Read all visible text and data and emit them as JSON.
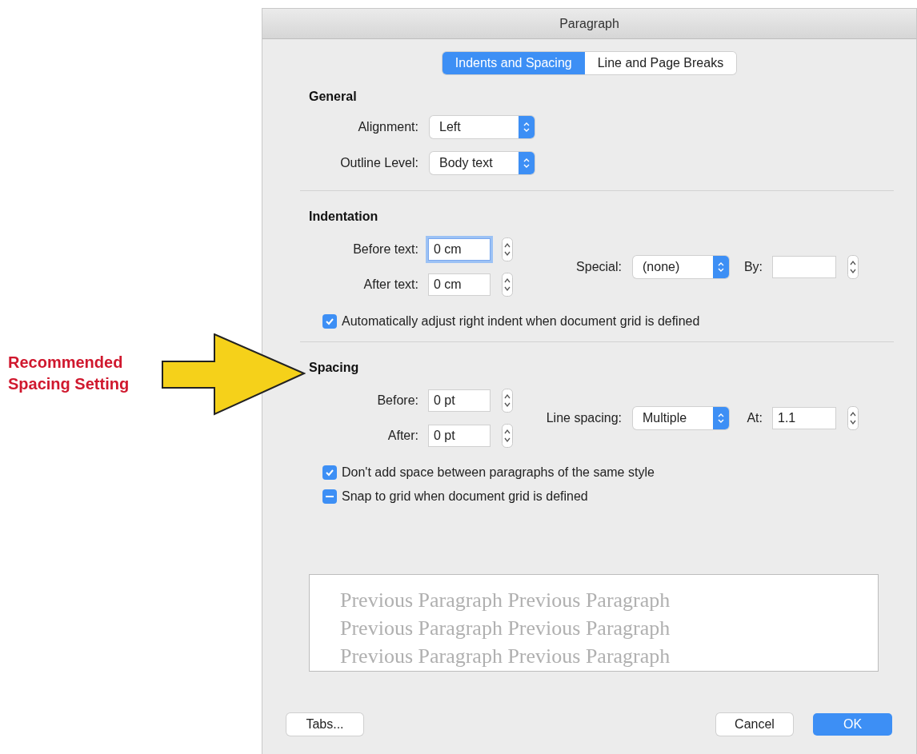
{
  "annotation": {
    "lines": [
      "Recommended",
      "Spacing Setting"
    ]
  },
  "dialog": {
    "title": "Paragraph",
    "tabs": [
      {
        "label": "Indents and Spacing",
        "selected": true
      },
      {
        "label": "Line and Page Breaks",
        "selected": false
      }
    ],
    "general": {
      "heading": "General",
      "popups": [
        {
          "label": "Alignment:",
          "value": "Left"
        },
        {
          "label": "Outline Level:",
          "value": "Body text"
        }
      ]
    },
    "indentation": {
      "heading": "Indentation",
      "fields": [
        {
          "label": "Before text:",
          "value": "0 cm",
          "focused": true
        },
        {
          "label": "After text:",
          "value": "0 cm",
          "focused": false
        }
      ],
      "popup": {
        "label": "Special:",
        "value": "(none)"
      },
      "extra_field": {
        "label": "By:",
        "focused": false
      },
      "checkboxes": [
        {
          "label": "Automatically adjust right indent when document grid is defined",
          "kind": "checkbox",
          "checked": true
        }
      ]
    },
    "spacing": {
      "heading": "Spacing",
      "fields": [
        {
          "label": "Before:",
          "value": "0 pt",
          "focused": false
        },
        {
          "label": "After:",
          "value": "0 pt",
          "focused": false
        }
      ],
      "popup": {
        "label": "Line spacing:",
        "value": "Multiple"
      },
      "extra_field": {
        "label": "At:",
        "value": "1.1",
        "focused": false
      },
      "checkboxes": [
        {
          "label": "Don't add space between paragraphs of the same style",
          "kind": "checkbox",
          "checked": true
        },
        {
          "label": "Snap to grid when document grid is defined",
          "kind": "tristate",
          "checked": true
        }
      ]
    },
    "preview": {
      "lines": [
        "Previous Paragraph Previous Paragraph",
        "Previous Paragraph Previous Paragraph",
        "Previous Paragraph Previous Paragraph"
      ]
    },
    "buttons": [
      {
        "label": "Tabs...",
        "kind": "normal"
      },
      {
        "label": "Cancel",
        "kind": "normal"
      },
      {
        "label": "OK",
        "kind": "default"
      }
    ]
  }
}
